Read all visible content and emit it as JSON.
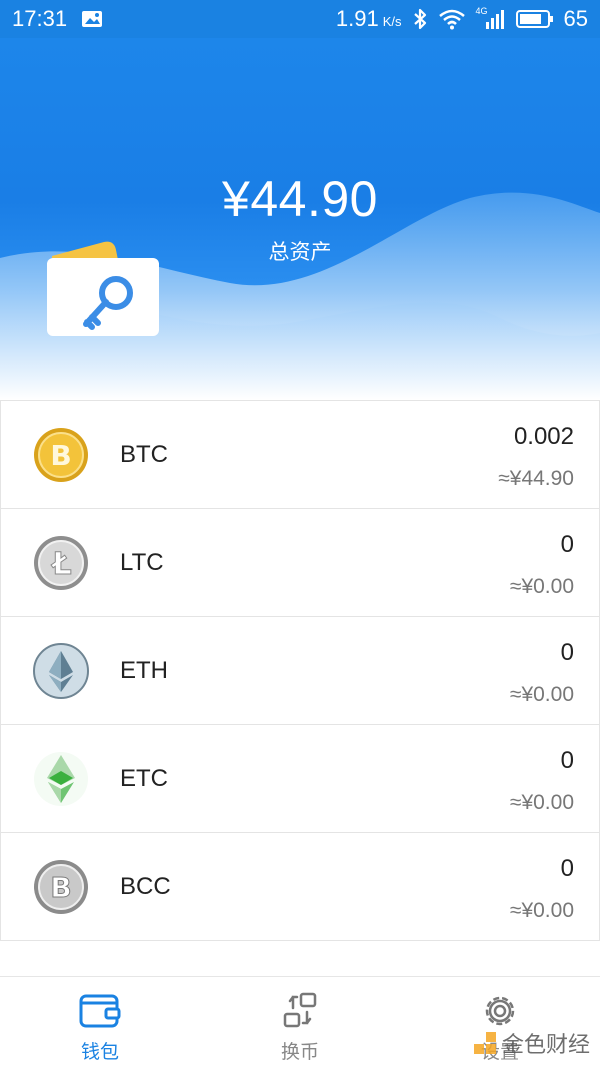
{
  "status_bar": {
    "time": "17:31",
    "net_speed": "1.91",
    "net_speed_unit": "K/s",
    "battery": "65",
    "network_type": "4G",
    "icons": [
      "image-notification-icon",
      "bluetooth-icon",
      "wifi-icon",
      "signal-icon",
      "battery-icon"
    ]
  },
  "header": {
    "balance": "¥44.90",
    "balance_label": "总资产",
    "accent": "#1a82e2"
  },
  "coins": [
    {
      "symbol": "BTC",
      "amount": "0.002",
      "value": "≈¥44.90",
      "icon": "bitcoin-icon"
    },
    {
      "symbol": "LTC",
      "amount": "0",
      "value": "≈¥0.00",
      "icon": "litecoin-icon"
    },
    {
      "symbol": "ETH",
      "amount": "0",
      "value": "≈¥0.00",
      "icon": "ethereum-icon"
    },
    {
      "symbol": "ETC",
      "amount": "0",
      "value": "≈¥0.00",
      "icon": "ethereum-classic-icon"
    },
    {
      "symbol": "BCC",
      "amount": "0",
      "value": "≈¥0.00",
      "icon": "bitcoin-cash-icon"
    }
  ],
  "nav": {
    "wallet": "钱包",
    "exchange": "换币",
    "settings": "设置",
    "active": "wallet"
  },
  "watermark": {
    "text": "金色财经"
  }
}
